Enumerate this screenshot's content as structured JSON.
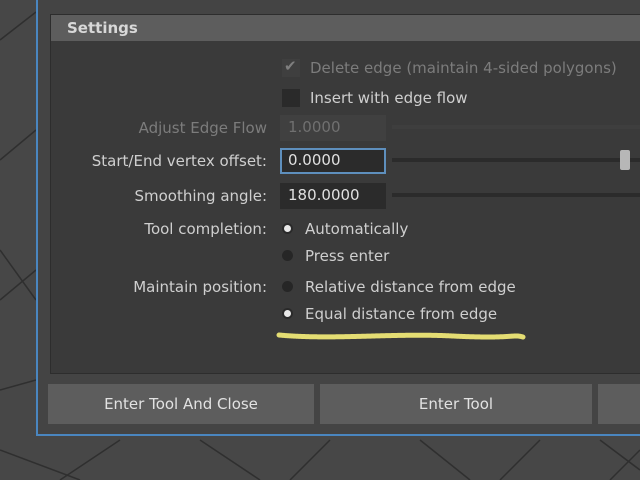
{
  "settings": {
    "header": "Settings",
    "delete_edge": {
      "label": "Delete edge (maintain 4-sided polygons)",
      "checked": true,
      "enabled": false
    },
    "insert_edge_flow": {
      "label": "Insert with edge flow",
      "checked": false,
      "enabled": true
    },
    "adjust_edge_flow": {
      "label": "Adjust Edge Flow",
      "value": "1.0000",
      "enabled": false
    },
    "vertex_offset": {
      "label": "Start/End vertex offset:",
      "value": "0.0000",
      "slider_fraction": 1.0
    },
    "smoothing_angle": {
      "label": "Smoothing angle:",
      "value": "180.0000"
    },
    "tool_completion": {
      "label": "Tool completion:",
      "options": [
        "Automatically",
        "Press enter"
      ],
      "selected": "Automatically"
    },
    "maintain_position": {
      "label": "Maintain position:",
      "options": [
        "Relative distance from edge",
        "Equal distance from edge"
      ],
      "selected": "Equal distance from edge"
    }
  },
  "buttons": {
    "enter_tool_and_close": "Enter Tool And Close",
    "enter_tool": "Enter Tool"
  },
  "colors": {
    "dialog_border": "#4a86c0",
    "highlight": "#f7ef7a"
  },
  "icons": {
    "checkbox_checked": "checkmark-icon"
  }
}
